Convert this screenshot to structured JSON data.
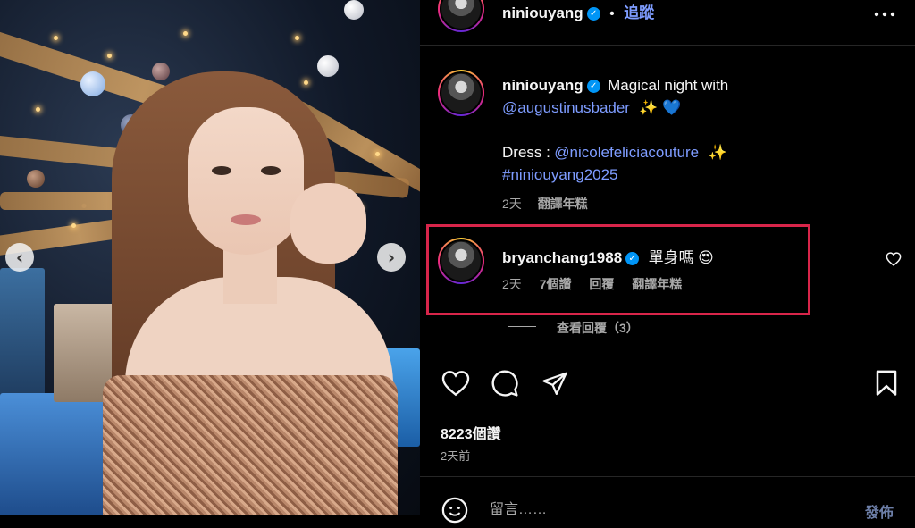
{
  "header": {
    "username": "niniouyang",
    "dot": "•",
    "follow_label": "追蹤",
    "more_icon": "more-horizontal-icon"
  },
  "caption": {
    "username": "niniouyang",
    "text_1": "Magical night with",
    "mention_1": "@augustinusbader",
    "emoji_1": "✨ 💙",
    "dress_label": "Dress :",
    "mention_2": "@nicolefeliciacouture",
    "emoji_2": "✨",
    "hashtag": "#niniouyang2025",
    "time": "2天",
    "translate": "翻譯年糕"
  },
  "comment": {
    "username": "bryanchang1988",
    "text": "單身嗎",
    "emoji": "😍",
    "time": "2天",
    "likes": "7個讚",
    "reply": "回覆",
    "translate": "翻譯年糕",
    "view_replies": "查看回覆（3）"
  },
  "actions": {
    "likes_count": "8223個讚",
    "posted": "2天前"
  },
  "composer": {
    "placeholder": "留言……",
    "post_label": "發佈"
  },
  "colors": {
    "highlight": "#d8254a",
    "link": "#7e9cff",
    "verified": "#0095f6"
  }
}
